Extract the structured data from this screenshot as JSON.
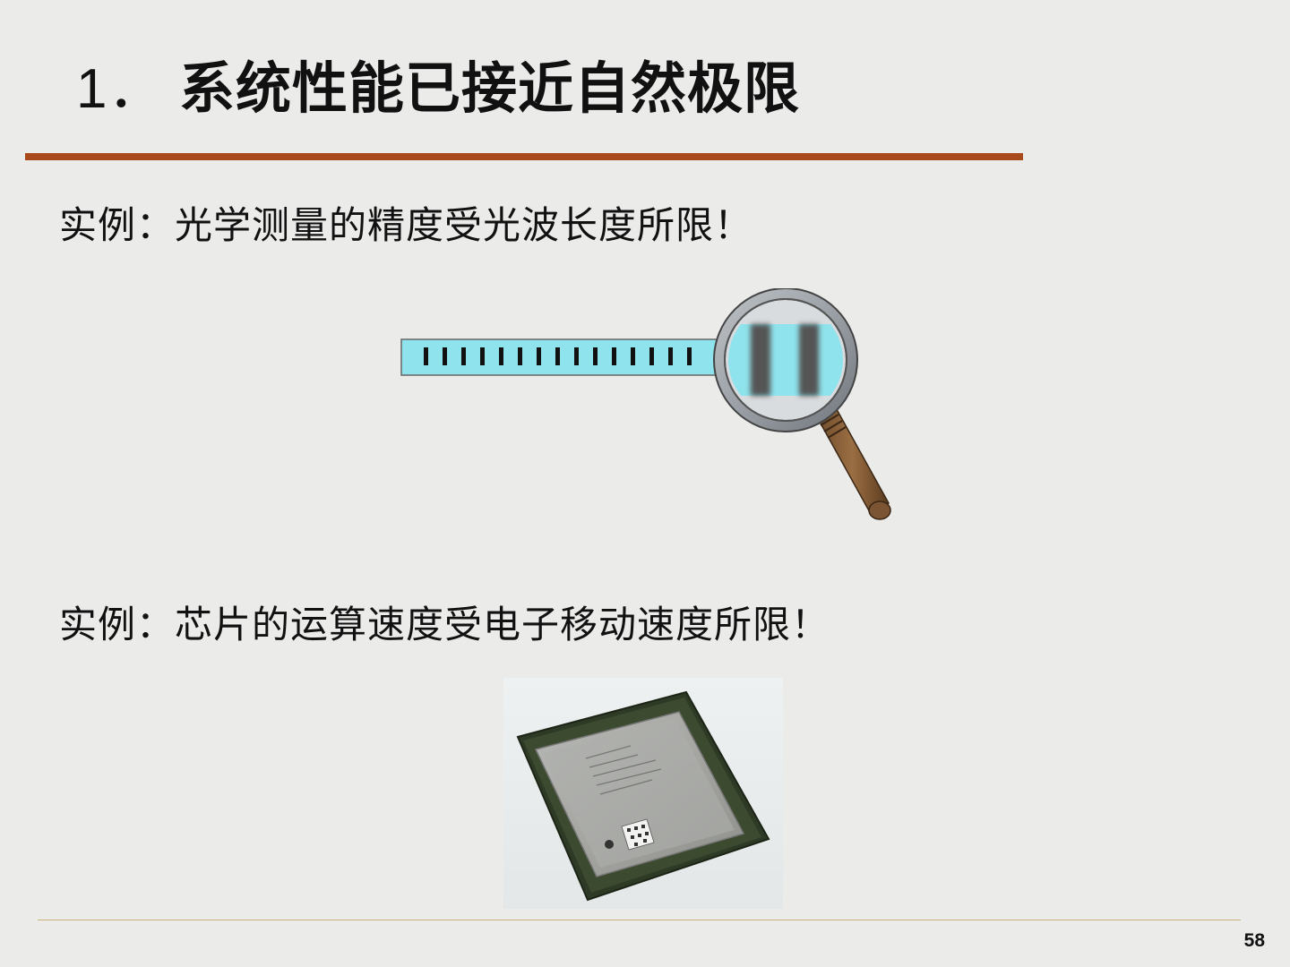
{
  "slide": {
    "title_number": "1．",
    "title_text": "系统性能已接近自然极限",
    "example_1": "实例：光学测量的精度受光波长度所限！",
    "example_2": "实例：芯片的运算速度受电子移动速度所限！",
    "page_number": "58"
  },
  "colors": {
    "background": "#ebebea",
    "title_rule": "#a84a1c",
    "ruler_fill": "#8fe3ec",
    "footer_rule": "#c9b27a"
  },
  "icons": {
    "figure_1": "ruler-under-magnifier-illustration",
    "figure_2": "cpu-chip-photo"
  }
}
